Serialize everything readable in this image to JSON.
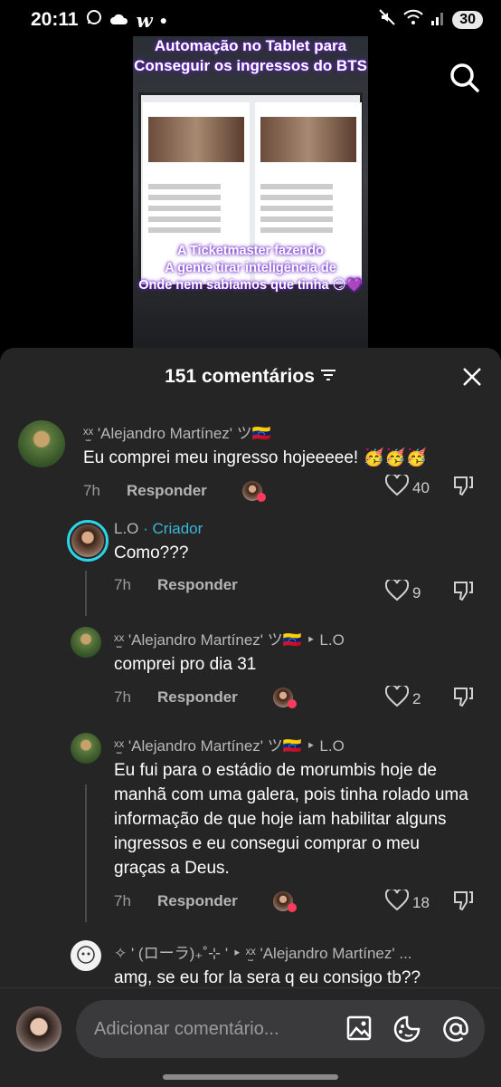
{
  "status_bar": {
    "time": "20:11",
    "battery": "30"
  },
  "video": {
    "title": "Automação no Tablet para Conseguir os ingressos do BTS",
    "caption_lines": [
      "A Ticketmaster fazendo",
      "A gente tirar inteligência de",
      "Onde nem sabíamos que tinha 😏💜"
    ]
  },
  "comments_header": {
    "count_label": "151 comentários"
  },
  "comments": [
    {
      "name": "ˣ̫ˣ 'Alejandro Martínez' ツ🇻🇪",
      "text": "Eu comprei meu ingresso hojeeeee! 🥳🥳🥳",
      "time": "7h",
      "reply_label": "Responder",
      "likes": "40"
    },
    {
      "name": "L.O",
      "creator_badge": "· Criador",
      "text": "Como???",
      "time": "7h",
      "reply_label": "Responder",
      "likes": "9"
    },
    {
      "name": "ˣ̫ˣ 'Alejandro Martínez' ツ🇻🇪 ‣ L.O",
      "text": "comprei pro dia 31",
      "time": "7h",
      "reply_label": "Responder",
      "likes": "2"
    },
    {
      "name": "ˣ̫ˣ 'Alejandro Martínez' ツ🇻🇪 ‣ L.O",
      "text": "Eu fui para o estádio de morumbis hoje de manhã com uma galera, pois tinha rolado uma informação de que hoje iam habilitar alguns ingressos e eu consegui comprar o meu graças a Deus.",
      "time": "7h",
      "reply_label": "Responder",
      "likes": "18"
    },
    {
      "name": "✧ ' (ローラ)₊˚⊹ ' ‣ ˣ̫ˣ 'Alejandro Martínez' ...",
      "text": "amg, se eu for la sera q eu consigo tb??"
    }
  ],
  "composer": {
    "placeholder": "Adicionar comentário..."
  },
  "colors": {
    "creator": "#3ab8d6",
    "sheet": "#252526",
    "like_heart": "#ff3b5c"
  }
}
